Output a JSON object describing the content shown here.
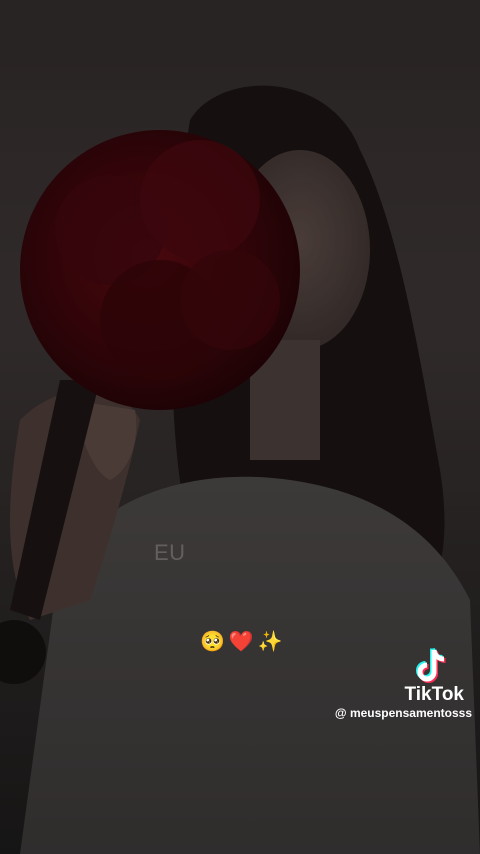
{
  "video": {
    "caption": "EU",
    "emojis": [
      "🥺",
      "❤️",
      "✨"
    ]
  },
  "watermark": {
    "brand": "TikTok",
    "username": "@ meuspensamentosss"
  },
  "icons": {
    "brand_logo": "tiktok-logo-icon"
  }
}
